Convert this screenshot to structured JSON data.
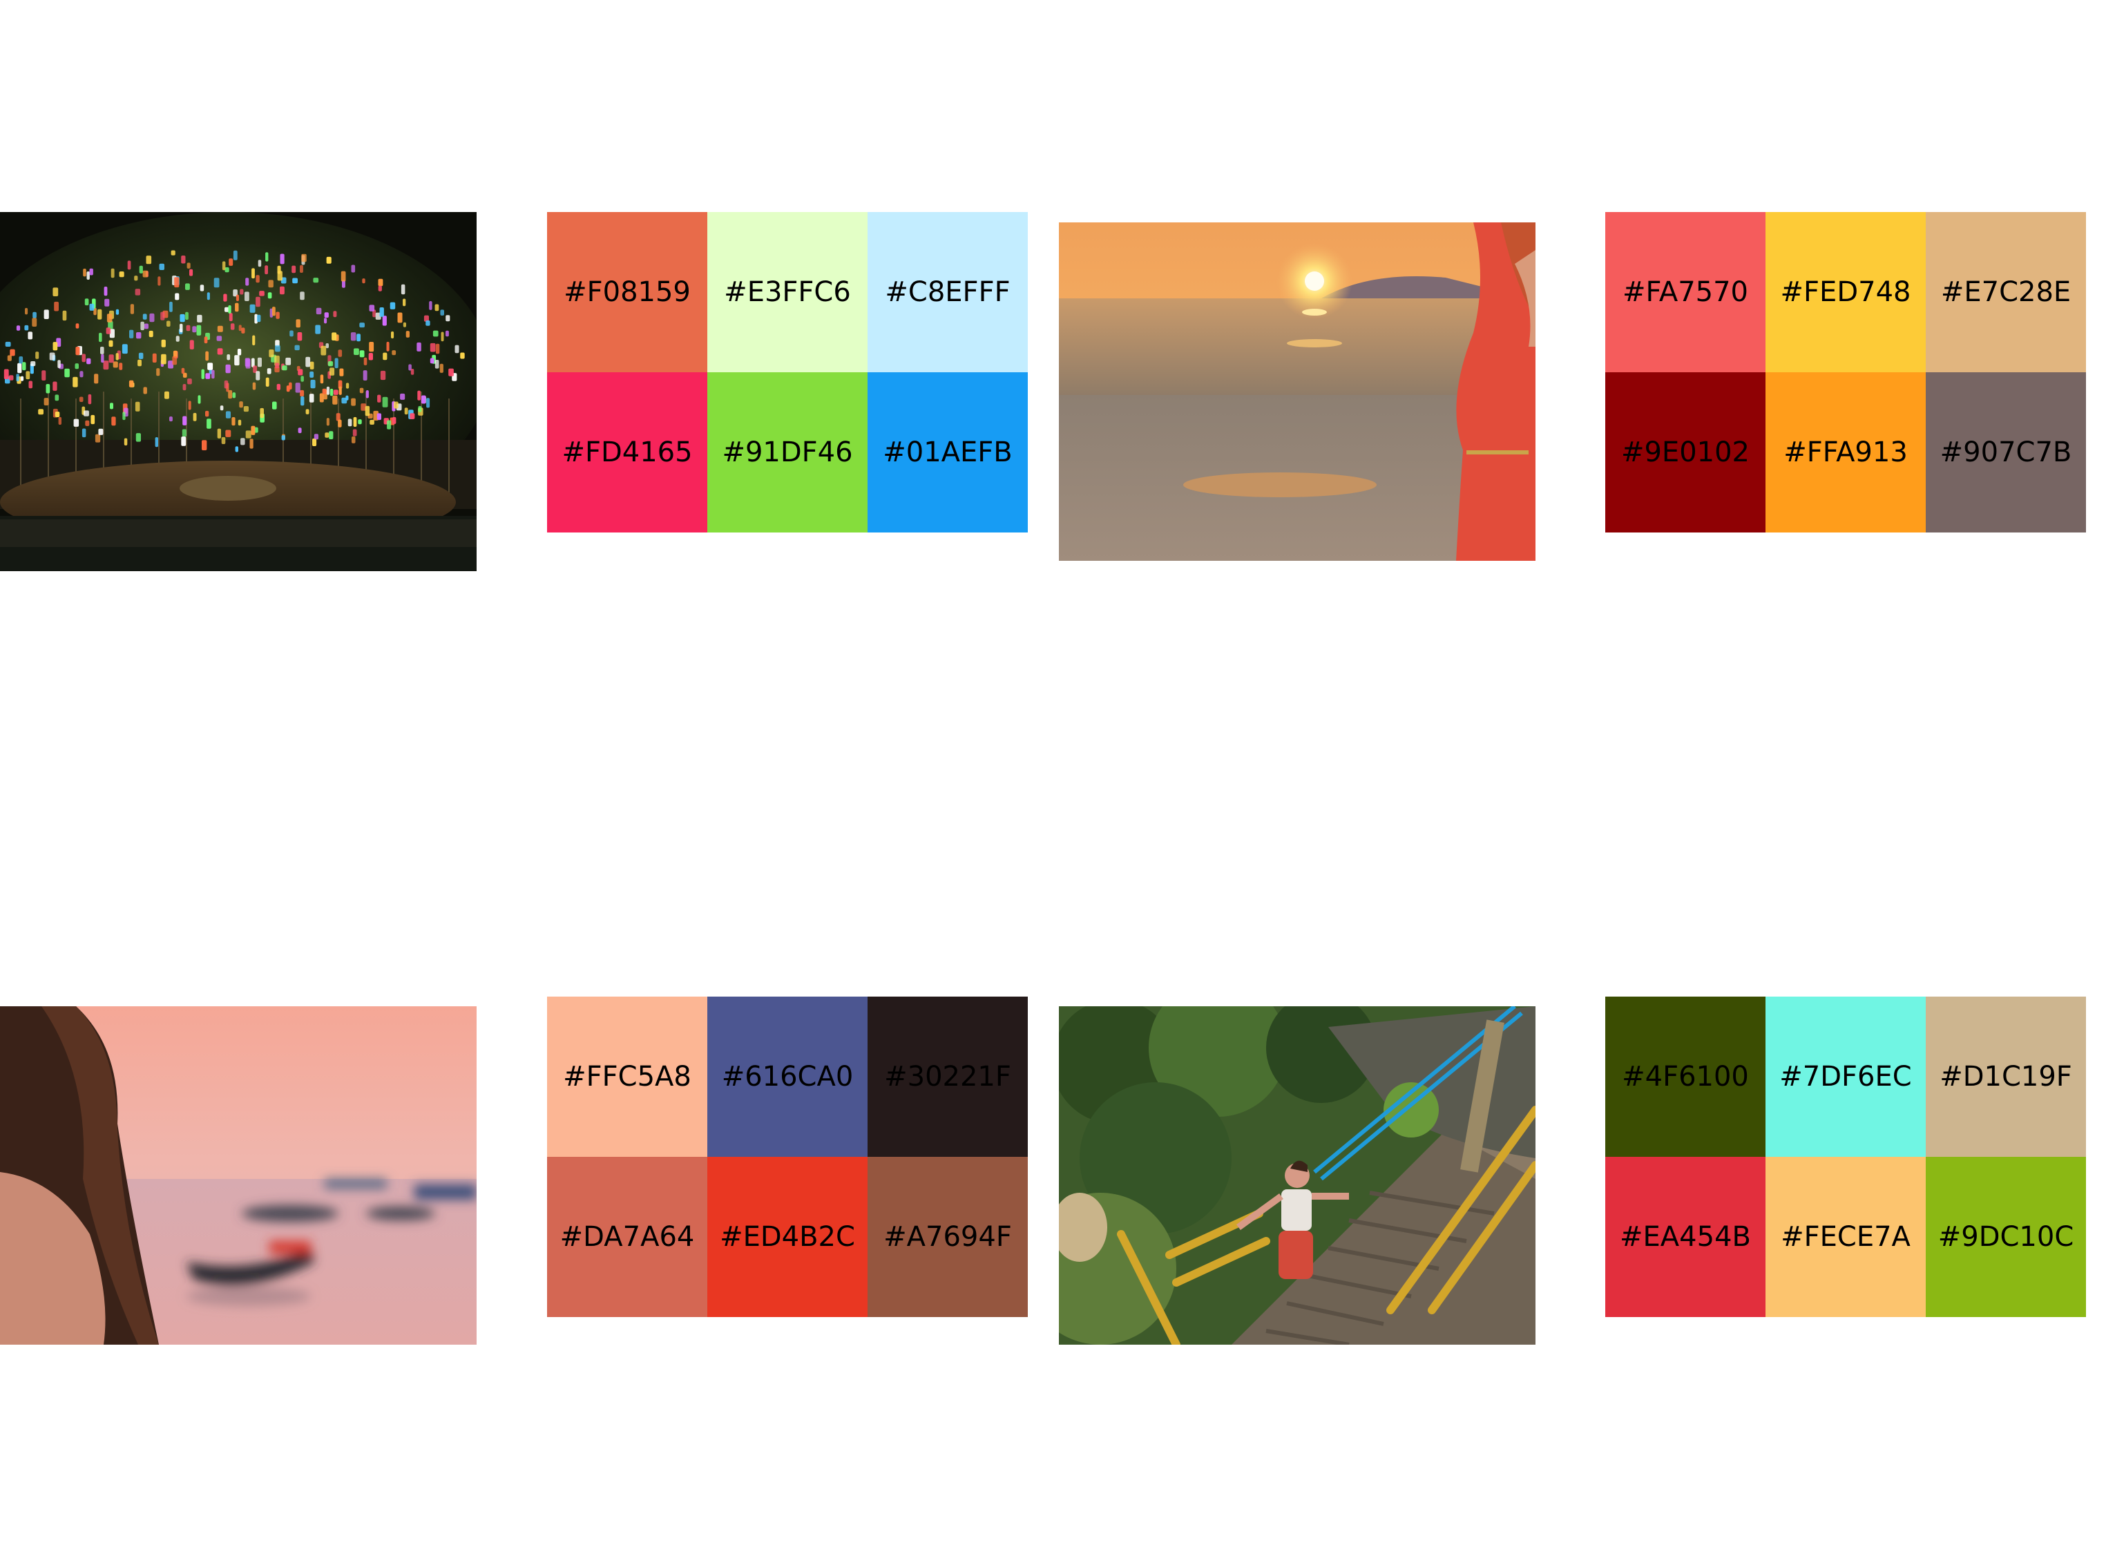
{
  "photos": [
    {
      "name": "lantern-tree-photo"
    },
    {
      "name": "beach-sunset-photo"
    },
    {
      "name": "blurred-boat-photo"
    },
    {
      "name": "temple-stairs-photo"
    }
  ],
  "palettes": [
    {
      "swatches": [
        {
          "label": "#F08159",
          "color": "#E86B4A"
        },
        {
          "label": "#E3FFC6",
          "color": "#E3FFC6"
        },
        {
          "label": "#C8EFFF",
          "color": "#C3EDFF"
        },
        {
          "label": "#FD4165",
          "color": "#F7245A"
        },
        {
          "label": "#91DF46",
          "color": "#85DD3C"
        },
        {
          "label": "#01AEFB",
          "color": "#179CF4"
        }
      ]
    },
    {
      "swatches": [
        {
          "label": "#FA7570",
          "color": "#F55C5C"
        },
        {
          "label": "#FED748",
          "color": "#FDCB37"
        },
        {
          "label": "#E7C28E",
          "color": "#E1B57F"
        },
        {
          "label": "#9E0102",
          "color": "#8F0104"
        },
        {
          "label": "#FFA913",
          "color": "#FF9D1B"
        },
        {
          "label": "#907C7B",
          "color": "#776563"
        }
      ]
    },
    {
      "swatches": [
        {
          "label": "#FFC5A8",
          "color": "#FCB694"
        },
        {
          "label": "#616CA0",
          "color": "#4C5691"
        },
        {
          "label": "#30221F",
          "color": "#251A1A"
        },
        {
          "label": "#DA7A64",
          "color": "#D46753"
        },
        {
          "label": "#ED4B2C",
          "color": "#E93722"
        },
        {
          "label": "#A7694F",
          "color": "#95563F"
        }
      ]
    },
    {
      "swatches": [
        {
          "label": "#4F6100",
          "color": "#3B4D02"
        },
        {
          "label": "#7DF6EC",
          "color": "#70F5E3"
        },
        {
          "label": "#D1C19F",
          "color": "#CDB58F"
        },
        {
          "label": "#EA454B",
          "color": "#E22F3D"
        },
        {
          "label": "#FECE7A",
          "color": "#FCC46E"
        },
        {
          "label": "#9DC10C",
          "color": "#8BB814"
        }
      ]
    }
  ]
}
